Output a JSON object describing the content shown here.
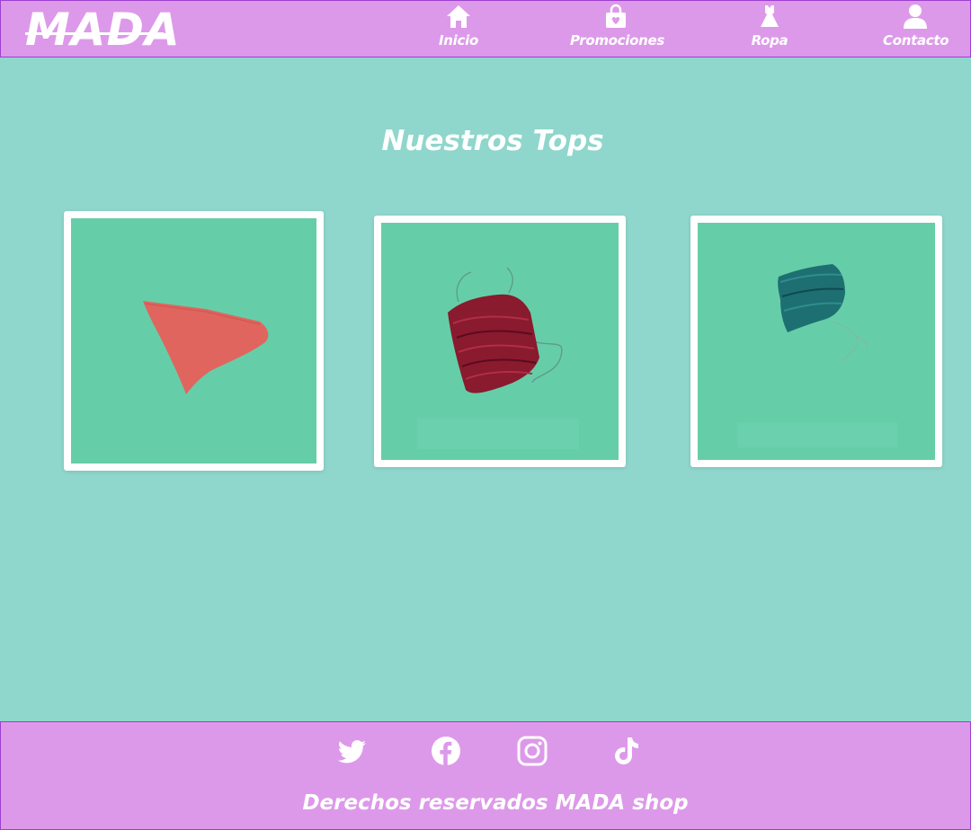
{
  "header": {
    "logo": "MADA",
    "nav": [
      {
        "label": "Inicio",
        "icon": "home-icon"
      },
      {
        "label": "Promociones",
        "icon": "shopping-bag-icon"
      },
      {
        "label": "Ropa",
        "icon": "dress-icon"
      },
      {
        "label": "Contacto",
        "icon": "user-icon"
      }
    ]
  },
  "main": {
    "title": "Nuestros Tops",
    "products": [
      {
        "name": "coral-top",
        "color": "#e0655f"
      },
      {
        "name": "burgundy-ruched-top",
        "color": "#8a1a2e"
      },
      {
        "name": "teal-ruched-top",
        "color": "#1e6f72"
      }
    ]
  },
  "footer": {
    "social": [
      "twitter-icon",
      "facebook-icon",
      "instagram-icon",
      "tiktok-icon"
    ],
    "copyright": "Derechos reservados MADA shop"
  },
  "colors": {
    "header_bg": "#dd99e9",
    "page_bg": "#8fd6cc",
    "photo_bg": "#65cea8",
    "border": "#9b3fd0"
  }
}
